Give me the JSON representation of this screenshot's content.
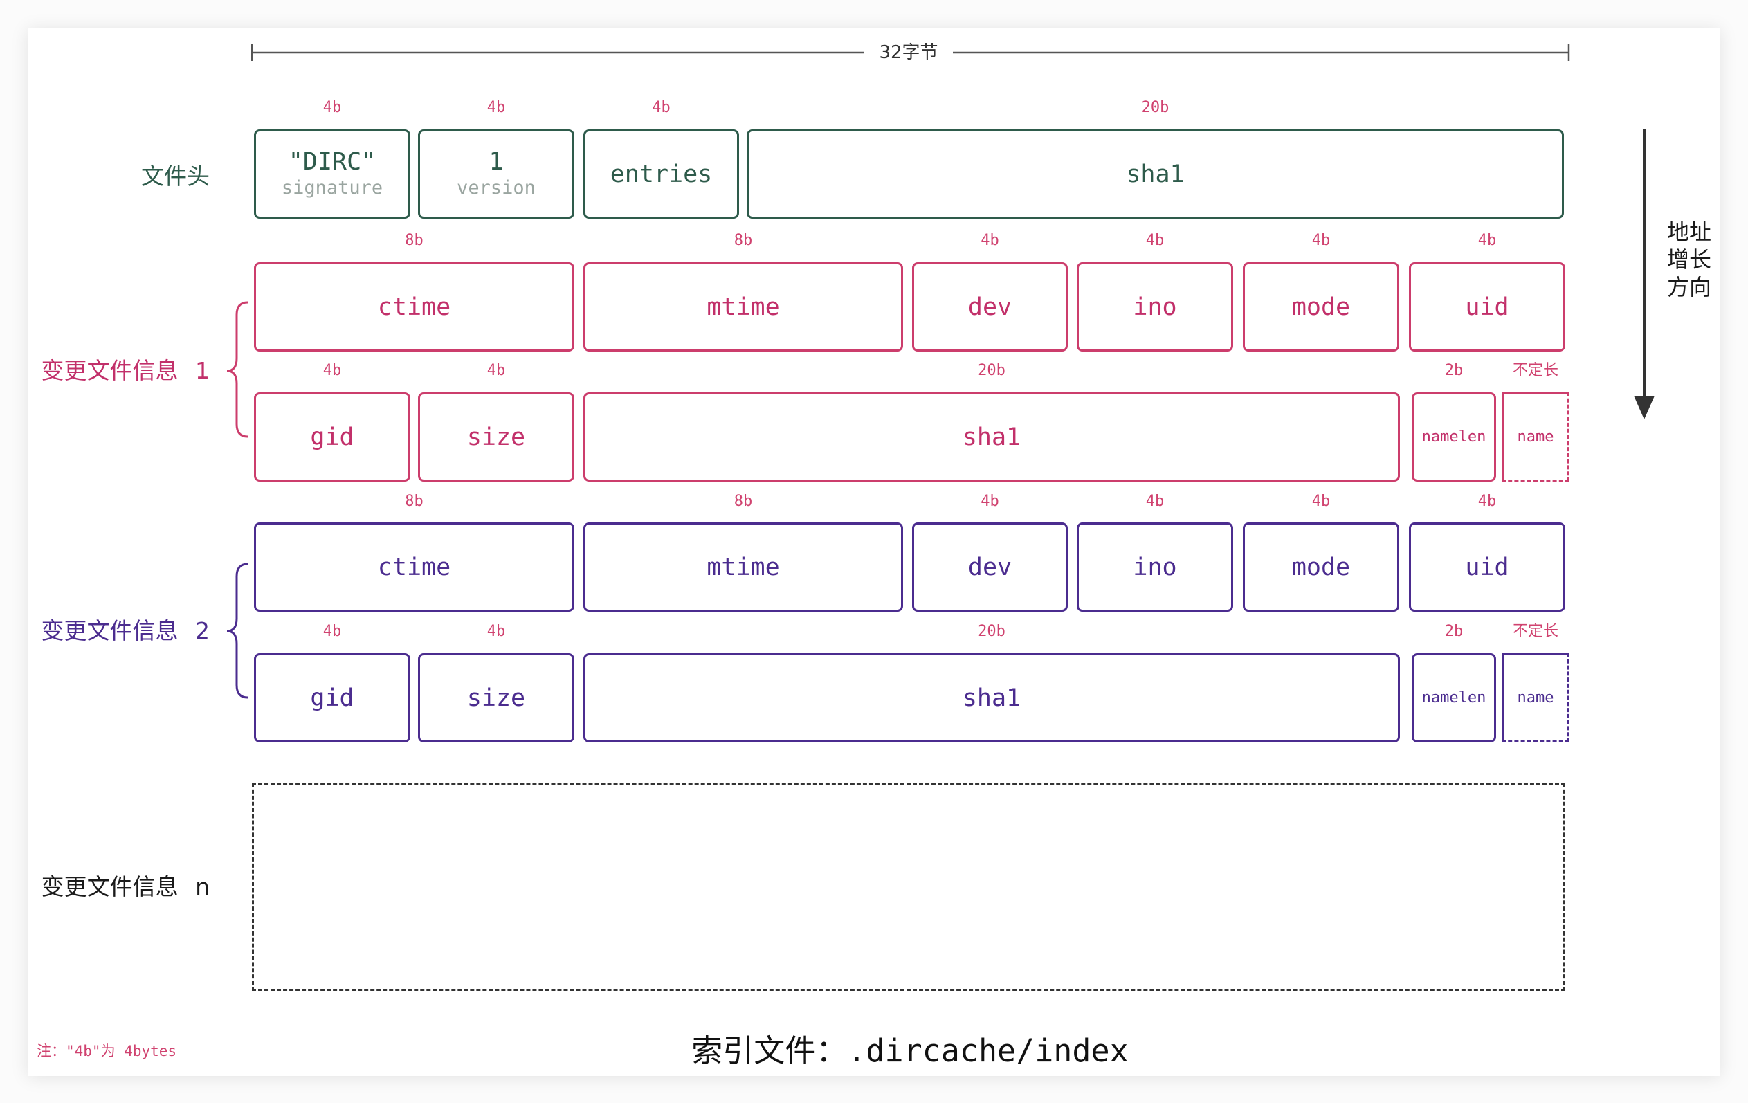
{
  "width_dimension": {
    "label": "32字节"
  },
  "address_direction": {
    "lines": [
      "地址",
      "增长",
      "方向"
    ]
  },
  "file_header": {
    "label": "文件头",
    "fields": [
      {
        "size": "4b",
        "name": "\"DIRC\"",
        "sub": "signature"
      },
      {
        "size": "4b",
        "name": "1",
        "sub": "version"
      },
      {
        "size": "4b",
        "name": "entries"
      },
      {
        "size": "20b",
        "name": "sha1"
      }
    ]
  },
  "entries": [
    {
      "label": "变更文件信息 1",
      "row1": [
        {
          "size": "8b",
          "name": "ctime"
        },
        {
          "size": "8b",
          "name": "mtime"
        },
        {
          "size": "4b",
          "name": "dev"
        },
        {
          "size": "4b",
          "name": "ino"
        },
        {
          "size": "4b",
          "name": "mode"
        },
        {
          "size": "4b",
          "name": "uid"
        }
      ],
      "row2": [
        {
          "size": "4b",
          "name": "gid"
        },
        {
          "size": "4b",
          "name": "size"
        },
        {
          "size": "20b",
          "name": "sha1"
        },
        {
          "size": "2b",
          "name": "namelen"
        },
        {
          "size": "不定长",
          "name": "name"
        }
      ]
    },
    {
      "label": "变更文件信息 2",
      "row1": [
        {
          "size": "8b",
          "name": "ctime"
        },
        {
          "size": "8b",
          "name": "mtime"
        },
        {
          "size": "4b",
          "name": "dev"
        },
        {
          "size": "4b",
          "name": "ino"
        },
        {
          "size": "4b",
          "name": "mode"
        },
        {
          "size": "4b",
          "name": "uid"
        }
      ],
      "row2": [
        {
          "size": "4b",
          "name": "gid"
        },
        {
          "size": "4b",
          "name": "size"
        },
        {
          "size": "20b",
          "name": "sha1"
        },
        {
          "size": "2b",
          "name": "namelen"
        },
        {
          "size": "不定长",
          "name": "name"
        }
      ]
    }
  ],
  "entry_n": {
    "label": "变更文件信息 n"
  },
  "footnote": "注：\"4b\"为 4bytes",
  "title": "索引文件：.dircache/index",
  "colors": {
    "file_header": "#2e5b4b",
    "entry_1": "#c2306a",
    "entry_2": "#4b2c8f",
    "size_label": "#d0426f",
    "entry_n": "#1a1a1a"
  }
}
